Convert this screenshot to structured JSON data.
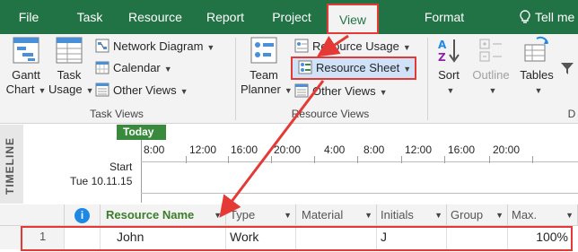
{
  "tabs": [
    {
      "label": "File",
      "active": false
    },
    {
      "label": "Task",
      "active": false
    },
    {
      "label": "Resource",
      "active": false
    },
    {
      "label": "Report",
      "active": false
    },
    {
      "label": "Project",
      "active": false
    },
    {
      "label": "View",
      "active": true
    },
    {
      "label": "Format",
      "active": false
    }
  ],
  "tell_me": "Tell me",
  "task_views": {
    "gantt_chart_line1": "Gantt",
    "gantt_chart_line2": "Chart",
    "task_usage_line1": "Task",
    "task_usage_line2": "Usage",
    "network_diagram": "Network Diagram",
    "calendar": "Calendar",
    "other_views": "Other Views",
    "group_label": "Task Views"
  },
  "resource_views": {
    "team_planner_line1": "Team",
    "team_planner_line2": "Planner",
    "resource_usage": "Resource Usage",
    "resource_sheet": "Resource Sheet",
    "other_views": "Other Views",
    "group_label": "Resource Views"
  },
  "data_group": {
    "sort": "Sort",
    "outline": "Outline",
    "tables": "Tables",
    "group_label": "D"
  },
  "timeline": {
    "side_label": "TIMELINE",
    "today": "Today",
    "ticks": [
      "8:00",
      "12:00",
      "16:00",
      "20:00",
      "4:00",
      "8:00",
      "12:00",
      "16:00",
      "20:00"
    ],
    "start_label": "Start",
    "start_date": "Tue 10.11.15"
  },
  "grid": {
    "columns": [
      "Resource Name",
      "Type",
      "Material",
      "Initials",
      "Group",
      "Max."
    ],
    "rows": [
      {
        "id": "1",
        "name": "John",
        "type": "Work",
        "material": "",
        "initials": "J",
        "group": "",
        "max": "100%"
      }
    ]
  },
  "colors": {
    "accent": "#217346",
    "highlight": "#e53935",
    "today": "#3a8a3e"
  }
}
